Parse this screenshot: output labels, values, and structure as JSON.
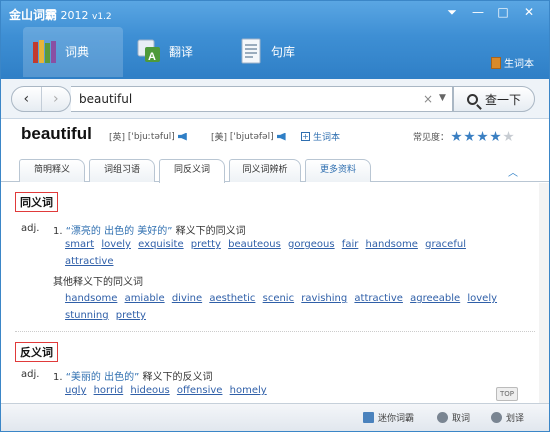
{
  "window": {
    "title": "金山词霸",
    "year": "2012",
    "version": "v1.2",
    "controls": {
      "menu": "⏷",
      "minimize": "—",
      "maximize": "□",
      "close": "✕"
    }
  },
  "nav": {
    "tabs": [
      {
        "label": "词典"
      },
      {
        "label": "翻译"
      },
      {
        "label": "句库"
      }
    ],
    "newword_label": "生词本"
  },
  "search": {
    "back": "‹",
    "forward": "›",
    "value": "beautiful",
    "clear": "×",
    "dropdown": "▼",
    "button_label": "查一下"
  },
  "entry": {
    "word": "beautiful",
    "phonetic_uk_prefix": "[英]",
    "phonetic_uk": "['bjuːtəful]",
    "phonetic_us_prefix": "[美]",
    "phonetic_us": "['bjutəfəl]",
    "add_newword": "生词本",
    "freq_label": "常见度：",
    "freq_stars": 4,
    "freq_max": 5
  },
  "subtabs": [
    {
      "label": "简明释义"
    },
    {
      "label": "词组习语"
    },
    {
      "label": "同反义词"
    },
    {
      "label": "同义词辨析"
    },
    {
      "label": "更多资料"
    }
  ],
  "synonyms": {
    "heading": "同义词",
    "pos": "adj.",
    "num": "1.",
    "gloss_quote": "“漂亮的 出色的 美好的”",
    "gloss_suffix": " 释义下的同义词",
    "words": [
      "smart",
      "lovely",
      "exquisite",
      "pretty",
      "beauteous",
      "gorgeous",
      "fair",
      "handsome",
      "graceful",
      "attractive"
    ],
    "other_heading": "其他释义下的同义词",
    "other_words": [
      "handsome",
      "amiable",
      "divine",
      "aesthetic",
      "scenic",
      "ravishing",
      "attractive",
      "agreeable",
      "lovely",
      "stunning",
      "pretty"
    ]
  },
  "antonyms": {
    "heading": "反义词",
    "pos": "adj.",
    "num": "1.",
    "gloss_quote": "“美丽的 出色的”",
    "gloss_suffix": " 释义下的反义词",
    "words": [
      "ugly",
      "horrid",
      "hideous",
      "offensive",
      "homely"
    ]
  },
  "top_label": "TOP",
  "status": {
    "mini": "迷你词霸",
    "take": "取词",
    "highlight": "划译"
  }
}
